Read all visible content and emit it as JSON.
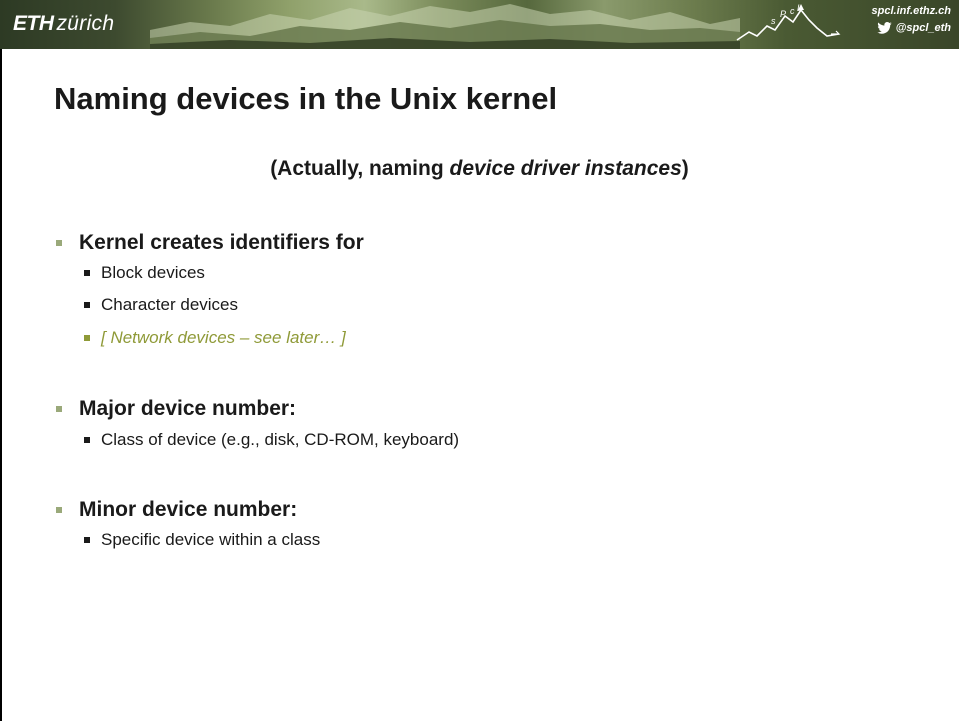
{
  "header": {
    "logo_bold": "ETH",
    "logo_rest": "zürich",
    "url": "spcl.inf.ethz.ch",
    "twitter_handle": "@spcl_eth",
    "icons": [
      "mountain-banner-image",
      "spcl-mountain-logo",
      "twitter-bird-icon"
    ]
  },
  "slide": {
    "title": "Naming devices in the Unix kernel",
    "subtitle": {
      "open": "(Actually, naming ",
      "italic": "device driver instances",
      "close": ")"
    },
    "bullets": [
      {
        "text": "Kernel creates identifiers for",
        "subitems": [
          "Block devices",
          "Character devices",
          "[ Network devices – see later… ]"
        ]
      },
      {
        "text": "Major device number:",
        "subitems": [
          "Class of device (e.g., disk, CD-ROM, keyboard)"
        ]
      },
      {
        "text": "Minor device number:",
        "subitems": [
          "Specific device within a class"
        ]
      }
    ]
  },
  "colors": {
    "header_dark": "#2d3a24",
    "header_light": "#a9b98a",
    "text": "#1a1a1a",
    "bullet_top": "#9aa97a",
    "olive_highlight": "#8f9a38"
  }
}
